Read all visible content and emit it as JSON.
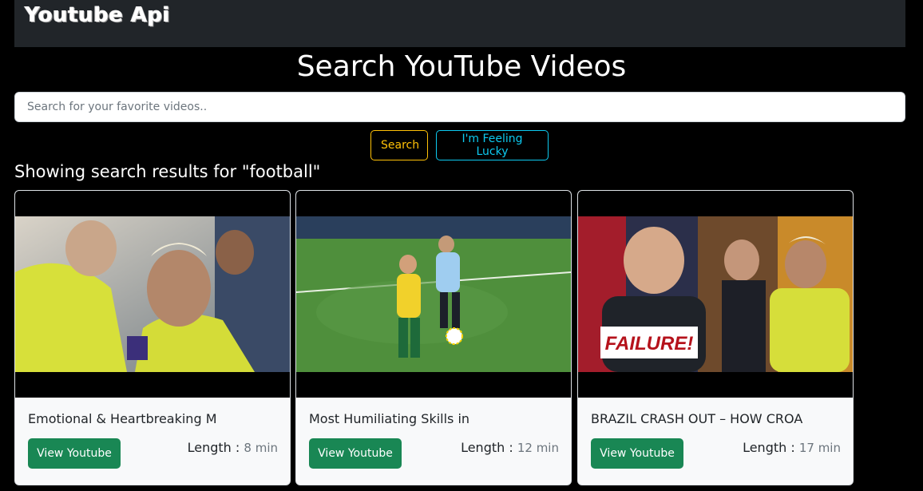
{
  "navbar": {
    "brand": "Youtube Api"
  },
  "page": {
    "title": "Search YouTube Videos"
  },
  "search": {
    "placeholder": "Search for your favorite videos..",
    "value": ""
  },
  "buttons": {
    "search_label": "Search",
    "lucky_label": "I'm Feeling Lucky"
  },
  "results": {
    "heading": "Showing search results for \"football\"",
    "cards": [
      {
        "title": "Emotional & Heartbreaking M",
        "button_label": "View Youtube",
        "length_label": "Length :",
        "length_value": "8 min"
      },
      {
        "title": "Most Humiliating Skills in",
        "button_label": "View Youtube",
        "length_label": "Length :",
        "length_value": "12 min"
      },
      {
        "title": "BRAZIL CRASH OUT – HOW CROA",
        "button_label": "View Youtube",
        "length_label": "Length :",
        "length_value": "17 min",
        "thumbnail_text": "FAILURE!"
      }
    ]
  },
  "colors": {
    "page_bg": "#000000",
    "navbar_bg": "#212529",
    "search_button": "#ffc107",
    "lucky_button": "#0dcaf0",
    "view_button": "#198754"
  }
}
